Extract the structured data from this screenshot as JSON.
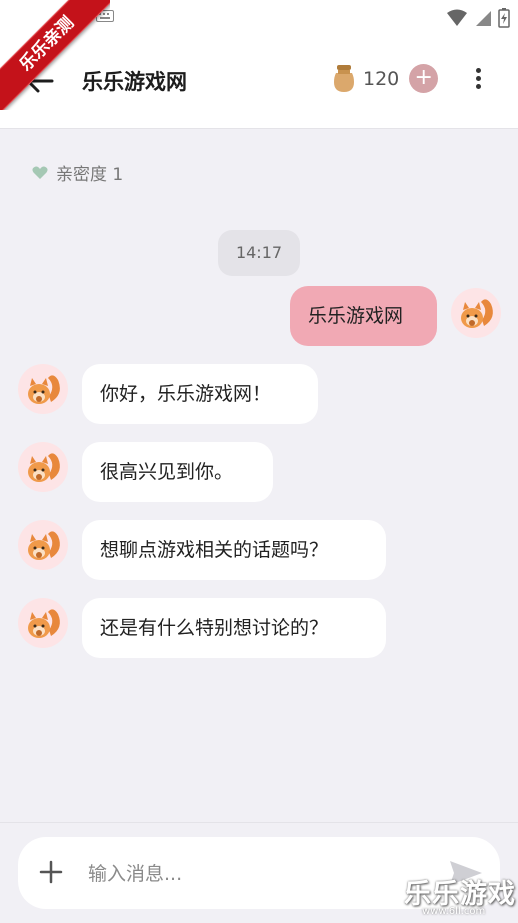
{
  "corner_ribbon": "乐乐亲测",
  "header": {
    "title": "乐乐游戏网",
    "coins": "120",
    "plus": "+"
  },
  "intimacy": {
    "label": "亲密度 1"
  },
  "chat": {
    "time": "14:17",
    "messages": [
      {
        "from": "me",
        "text": "乐乐游戏网"
      },
      {
        "from": "bot",
        "text": "你好，乐乐游戏网！"
      },
      {
        "from": "bot",
        "text": "很高兴见到你。"
      },
      {
        "from": "bot",
        "text": "想聊点游戏相关的话题吗？"
      },
      {
        "from": "bot",
        "text": "还是有什么特别想讨论的？"
      }
    ]
  },
  "input": {
    "placeholder": "输入消息..."
  },
  "watermark": {
    "brand": "乐乐游戏",
    "url": "www.6ll.com"
  },
  "colors": {
    "accent_pink": "#f1a9b4",
    "plus_button": "#d4a3a7",
    "background": "#f1f0f5",
    "ribbon_red": "#c4121a"
  },
  "icons": [
    "back-arrow-icon",
    "coin-jar-icon",
    "plus-icon",
    "more-vertical-icon",
    "heart-icon",
    "squirrel-avatar-icon",
    "add-icon",
    "send-icon",
    "wifi-icon",
    "signal-icon",
    "battery-icon",
    "keyboard-icon"
  ]
}
